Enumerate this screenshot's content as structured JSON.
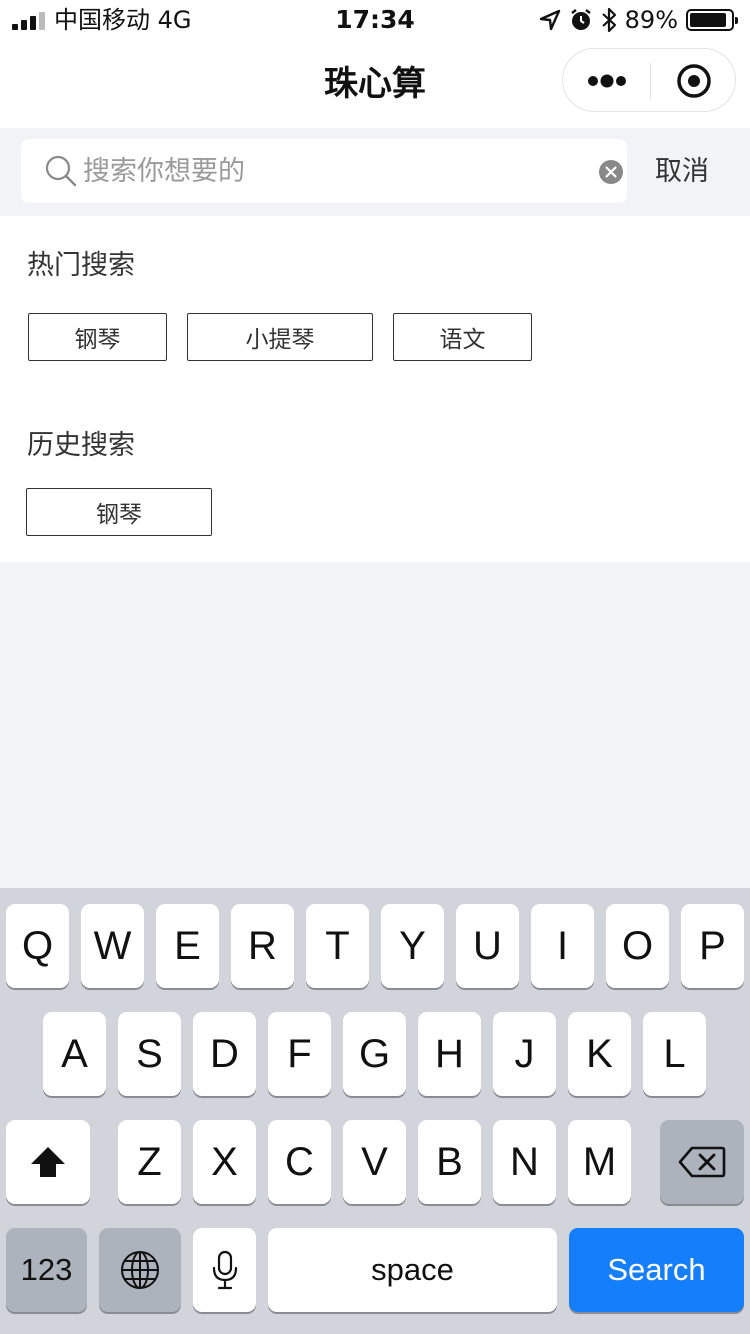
{
  "status_bar": {
    "carrier": "中国移动  4G",
    "time": "17:34",
    "battery_percent": "89%",
    "battery_level": 0.89,
    "icons": [
      "signal-icon",
      "location-icon",
      "alarm-icon",
      "bluetooth-icon",
      "battery-icon"
    ]
  },
  "nav": {
    "title": "珠心算",
    "capsule_icons": [
      "more-icon",
      "close-target-icon"
    ]
  },
  "search": {
    "placeholder": "搜索你想要的",
    "value": "",
    "cancel_label": "取消"
  },
  "hot_search": {
    "title": "热门搜索",
    "tags": [
      "钢琴",
      "小提琴",
      "语文"
    ]
  },
  "history_search": {
    "title": "历史搜索",
    "tags": [
      "钢琴"
    ]
  },
  "keyboard": {
    "row1": [
      "Q",
      "W",
      "E",
      "R",
      "T",
      "Y",
      "U",
      "I",
      "O",
      "P"
    ],
    "row2": [
      "A",
      "S",
      "D",
      "F",
      "G",
      "H",
      "J",
      "K",
      "L"
    ],
    "row3": [
      "Z",
      "X",
      "C",
      "V",
      "B",
      "N",
      "M"
    ],
    "numbers_label": "123",
    "space_label": "space",
    "search_label": "Search",
    "icons": [
      "shift-icon",
      "backspace-icon",
      "globe-icon",
      "microphone-icon"
    ]
  },
  "colors": {
    "search_key": "#147efb",
    "page_bg": "#f2f3f7",
    "keyboard_bg": "#d1d4da"
  }
}
